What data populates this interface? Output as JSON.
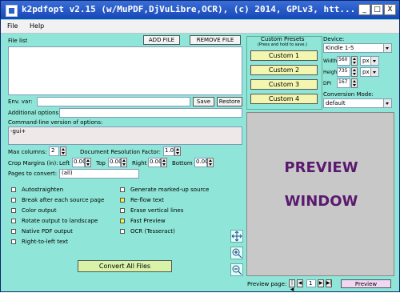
{
  "window": {
    "title": "k2pdfopt v2.15 (w/MuPDF,DjVuLibre,OCR), (c) 2014, GPLv3, htt..."
  },
  "titlebar_buttons": {
    "minimize": "_",
    "maximize": "□",
    "close": "X"
  },
  "menu": {
    "file": "File",
    "help": "Help"
  },
  "files": {
    "label": "File list",
    "add": "ADD FILE",
    "remove": "REMOVE FILE"
  },
  "env": {
    "label": "Env. var:",
    "save": "Save",
    "restore": "Restore"
  },
  "additional": {
    "label": "Additional options:"
  },
  "cmdline": {
    "label": "Command-line version of options:",
    "value": "-gui+"
  },
  "columns": {
    "label": "Max columns:",
    "value": "2"
  },
  "resolution": {
    "label": "Document  Resolution  Factor:",
    "value": "1.0"
  },
  "crop": {
    "label": "Crop Margins (in):",
    "left_label": "Left",
    "left_value": "0.00",
    "top_label": "Top",
    "top_value": "0.00",
    "right_label": "Right",
    "right_value": "0.00",
    "bottom_label": "Bottom",
    "bottom_value": "0.00"
  },
  "pages": {
    "label": "Pages to convert:",
    "value": "(all)"
  },
  "options_left": [
    {
      "label": "Autostraighten",
      "checked": false
    },
    {
      "label": "Break after each source page",
      "checked": false
    },
    {
      "label": "Color output",
      "checked": false
    },
    {
      "label": "Rotate output to landscape",
      "checked": false
    },
    {
      "label": "Native PDF output",
      "checked": false
    },
    {
      "label": "Right-to-left text",
      "checked": false
    }
  ],
  "options_right": [
    {
      "label": "Generate marked-up source",
      "checked": false
    },
    {
      "label": "Re-flow text",
      "checked": true
    },
    {
      "label": "Erase vertical lines",
      "checked": false
    },
    {
      "label": "Fast Preview",
      "checked": true
    },
    {
      "label": "OCR (Tesseract)",
      "checked": false
    }
  ],
  "convert": {
    "label": "Convert All Files"
  },
  "presets": {
    "title": "Custom Presets",
    "subtitle": "(Press and hold to save.)",
    "buttons": [
      "Custom 1",
      "Custom 2",
      "Custom 3",
      "Custom 4"
    ]
  },
  "device": {
    "label": "Device:",
    "value": "Kindle 1-5",
    "width_label": "Width",
    "width_value": "560",
    "width_unit": "px",
    "height_label": "Height",
    "height_value": "735",
    "height_unit": "px",
    "dpi_label": "DPI",
    "dpi_value": "167",
    "mode_label": "Conversion Mode:",
    "mode_value": "default"
  },
  "preview": {
    "line1": "PREVIEW",
    "line2": "WINDOW",
    "page_label": "Preview page:",
    "page_value": "1",
    "button": "Preview",
    "nav_first": "|◀",
    "nav_prev": "◀",
    "nav_next": "▶",
    "nav_last": "▶|"
  },
  "colors": {
    "background": "#8fe6d8",
    "titlebar": "#1746b8",
    "preview_text": "#5a1a6e",
    "preset_button": "#f4f6b0"
  }
}
